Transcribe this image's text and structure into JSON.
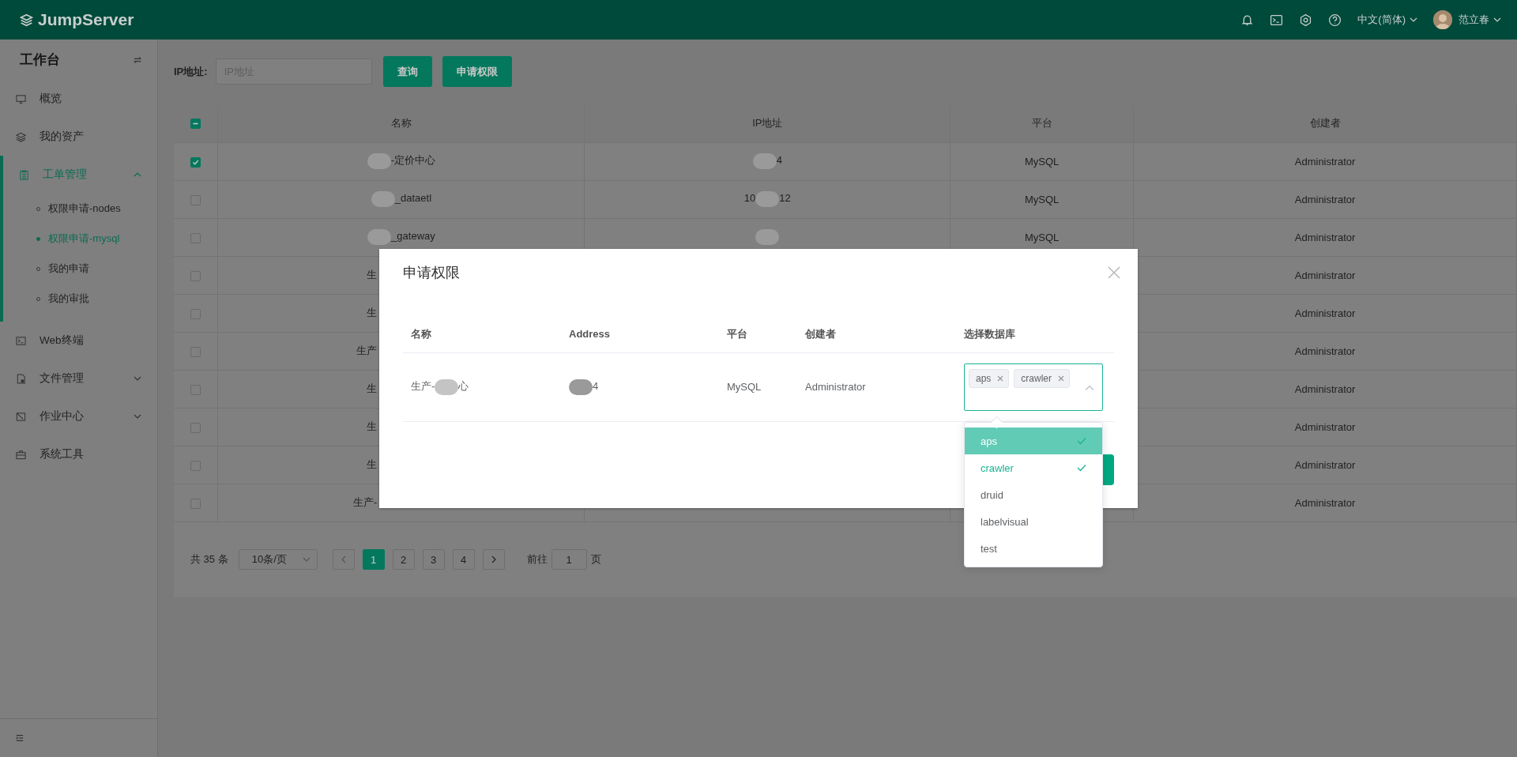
{
  "header": {
    "logo": "JumpServer",
    "language": "中文(简体)",
    "user": "范立春"
  },
  "sidebar": {
    "title": "工作台",
    "items": [
      {
        "label": "概览",
        "selected": false
      },
      {
        "label": "我的资产",
        "selected": false
      },
      {
        "label": "工单管理",
        "selected": true,
        "expanded": true,
        "children": [
          {
            "label": "权限申请-nodes",
            "selected": false
          },
          {
            "label": "权限申请-mysql",
            "selected": true
          },
          {
            "label": "我的申请",
            "selected": false
          },
          {
            "label": "我的审批",
            "selected": false
          }
        ]
      },
      {
        "label": "Web终端",
        "selected": false
      },
      {
        "label": "文件管理",
        "selected": false,
        "expanded": false
      },
      {
        "label": "作业中心",
        "selected": false,
        "expanded": false
      },
      {
        "label": "系统工具",
        "selected": false
      }
    ]
  },
  "search": {
    "label": "IP地址:",
    "placeholder": "IP地址",
    "buttons": [
      "查询",
      "申请权限"
    ]
  },
  "table": {
    "header_checkbox": {
      "indeterminate": true
    },
    "columns": [
      "名称",
      "IP地址",
      "平台",
      "创建者"
    ],
    "rows": [
      {
        "checked": true,
        "name": [
          {
            "kind": "redacted"
          },
          {
            "kind": "text",
            "text": "-定价中心"
          }
        ],
        "ip": [
          {
            "kind": "redacted"
          },
          {
            "kind": "text",
            "text": "4"
          }
        ],
        "platform": "MySQL",
        "creator": "Administrator",
        "clipped": false
      },
      {
        "checked": false,
        "name": [
          {
            "kind": "redacted"
          },
          {
            "kind": "text",
            "text": "_dataetl"
          }
        ],
        "ip": [
          {
            "kind": "text",
            "text": "10"
          },
          {
            "kind": "redacted"
          },
          {
            "kind": "text",
            "text": "12"
          }
        ],
        "platform": "MySQL",
        "creator": "Administrator",
        "clipped": false
      },
      {
        "checked": false,
        "name": [
          {
            "kind": "redacted"
          },
          {
            "kind": "text",
            "text": "_gateway"
          }
        ],
        "ip": [
          {
            "kind": "redacted"
          }
        ],
        "platform": "MySQL",
        "creator": "Administrator",
        "clipped": false
      },
      {
        "checked": false,
        "name": [
          {
            "kind": "text",
            "text": "生"
          }
        ],
        "creator": "Administrator",
        "clipped": true
      },
      {
        "checked": false,
        "name": [
          {
            "kind": "text",
            "text": "生"
          }
        ],
        "creator": "Administrator",
        "clipped": true
      },
      {
        "checked": false,
        "name": [
          {
            "kind": "text",
            "text": "生产"
          }
        ],
        "creator": "Administrator",
        "clipped": true
      },
      {
        "checked": false,
        "name": [
          {
            "kind": "text",
            "text": "生"
          }
        ],
        "creator": "Administrator",
        "clipped": true
      },
      {
        "checked": false,
        "name": [
          {
            "kind": "text",
            "text": "生"
          }
        ],
        "creator": "Administrator",
        "clipped": true
      },
      {
        "checked": false,
        "name": [
          {
            "kind": "text",
            "text": "生"
          }
        ],
        "creator": "Administrator",
        "clipped": true
      },
      {
        "checked": false,
        "name": [
          {
            "kind": "text",
            "text": "生产-"
          }
        ],
        "creator": "Administrator",
        "clipped": true
      }
    ]
  },
  "pagination": {
    "total": "共 35 条",
    "page_size": "10条/页",
    "pages": [
      {
        "label": "1",
        "selected": true
      },
      {
        "label": "2",
        "selected": false
      },
      {
        "label": "3",
        "selected": false
      },
      {
        "label": "4",
        "selected": false
      }
    ],
    "goto_label": "前往",
    "goto_value": "1",
    "goto_suffix": "页"
  },
  "dialog": {
    "title": "申请权限",
    "columns": [
      "名称",
      "Address",
      "平台",
      "创建者",
      "选择数据库"
    ],
    "row": {
      "name": [
        {
          "kind": "text",
          "text": "生产-"
        },
        {
          "kind": "redacted"
        },
        {
          "kind": "text",
          "text": "心"
        }
      ],
      "address": [
        {
          "kind": "redacted"
        },
        {
          "kind": "text",
          "text": "4"
        }
      ],
      "platform": "MySQL",
      "creator": "Administrator"
    },
    "select": {
      "open": true,
      "tags": [
        "aps",
        "crawler"
      ]
    },
    "options": [
      {
        "label": "aps",
        "selected": true,
        "highlighted": true
      },
      {
        "label": "crawler",
        "selected": true,
        "highlighted": false
      },
      {
        "label": "druid",
        "selected": false,
        "highlighted": false
      },
      {
        "label": "labelvisual",
        "selected": false,
        "highlighted": false
      },
      {
        "label": "test",
        "selected": false,
        "highlighted": false
      }
    ]
  }
}
